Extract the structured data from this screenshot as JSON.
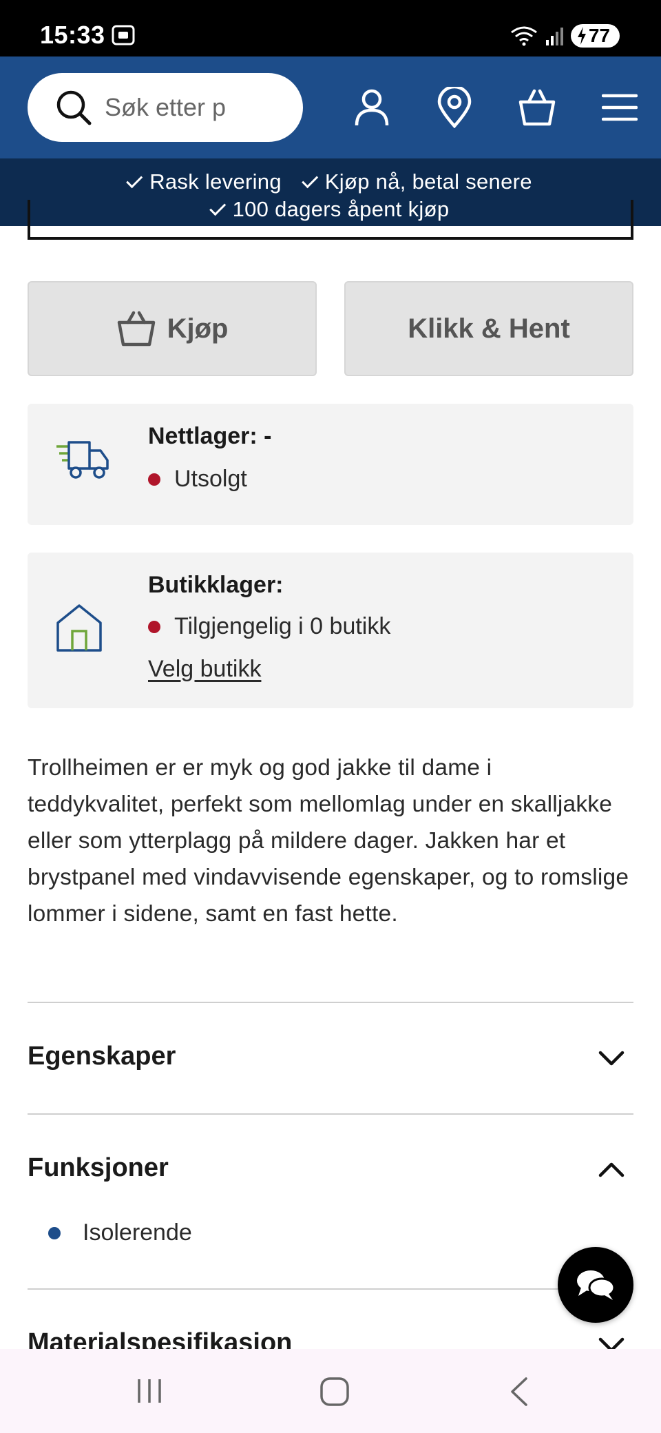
{
  "status": {
    "time": "15:33",
    "battery": "77"
  },
  "header": {
    "search_placeholder": "Søk etter p"
  },
  "usp": {
    "item1": "Rask levering",
    "item2": "Kjøp nå, betal senere",
    "item3": "100 dagers åpent kjøp"
  },
  "actions": {
    "buy_label": "Kjøp",
    "click_collect_label": "Klikk & Hent"
  },
  "online_stock": {
    "title": "Nettlager: -",
    "status": "Utsolgt"
  },
  "store_stock": {
    "title": "Butikklager:",
    "status": "Tilgjengelig i 0 butikk",
    "link": "Velg butikk"
  },
  "description": "Trollheimen er er myk og god jakke til dame i teddykvalitet, perfekt som mellomlag under en skalljakke eller som ytterplagg på mildere dager. Jakken har et brystpanel med vindavvisende egenskaper, og to romslige lommer i sidene, samt en fast hette.",
  "accordions": {
    "properties": "Egenskaper",
    "functions": "Funksjoner",
    "functions_items": [
      "Isolerende"
    ],
    "materials": "Materialspesifikasjon"
  },
  "colors": {
    "header": "#1d4d8a",
    "usp_bar": "#0d2b50",
    "status_red": "#b0152a",
    "bullet_blue": "#1d4d8a"
  }
}
